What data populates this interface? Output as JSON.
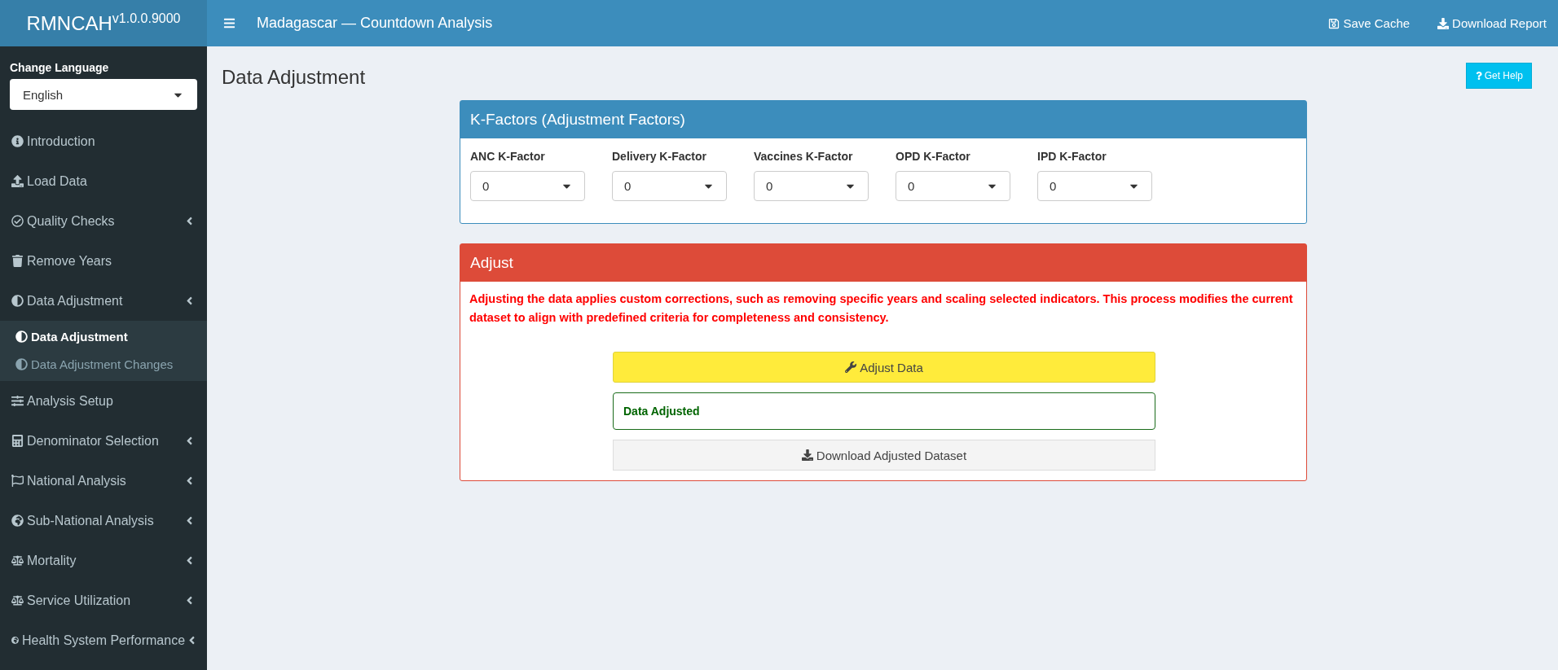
{
  "brand": {
    "title": "RMNCAH$^{v1.0.0.9000}$"
  },
  "header": {
    "title": "Madagascar — Countdown Analysis",
    "actions": [
      {
        "label": "Save Cache"
      },
      {
        "label": "Download Report"
      }
    ]
  },
  "sidebar": {
    "language_label": "Change Language",
    "language_value": "English",
    "items": [
      {
        "label": "Introduction",
        "has_submenu": false
      },
      {
        "label": "Load Data",
        "has_submenu": false
      },
      {
        "label": "Quality Checks",
        "has_submenu": true
      },
      {
        "label": "Remove Years",
        "has_submenu": false
      },
      {
        "label": "Data Adjustment",
        "has_submenu": true,
        "expanded": true,
        "children": [
          {
            "label": "Data Adjustment",
            "selected": true
          },
          {
            "label": "Data Adjustment Changes",
            "selected": false
          }
        ]
      },
      {
        "label": "Analysis Setup",
        "has_submenu": false
      },
      {
        "label": "Denominator Selection",
        "has_submenu": true
      },
      {
        "label": "National Analysis",
        "has_submenu": true
      },
      {
        "label": "Sub-National Analysis",
        "has_submenu": true
      },
      {
        "label": "Mortality",
        "has_submenu": true
      },
      {
        "label": "Service Utilization",
        "has_submenu": true
      },
      {
        "label": "Health System Performance",
        "has_submenu": true
      }
    ]
  },
  "page": {
    "title": "Data Adjustment",
    "help_button": "Get Help"
  },
  "kfactors_card": {
    "title": "K-Factors (Adjustment Factors)",
    "fields": [
      {
        "label": "ANC K-Factor",
        "value": "0"
      },
      {
        "label": "Delivery K-Factor",
        "value": "0"
      },
      {
        "label": "Vaccines K-Factor",
        "value": "0"
      },
      {
        "label": "OPD K-Factor",
        "value": "0"
      },
      {
        "label": "IPD K-Factor",
        "value": "0"
      }
    ]
  },
  "adjust_card": {
    "title": "Adjust",
    "description": "Adjusting the data applies custom corrections, such as removing specific years and scaling selected indicators. This process modifies the current dataset to align with predefined criteria for completeness and consistency.",
    "adjust_button": "Adjust Data",
    "status": "Data Adjusted",
    "download_button": "Download Adjusted Dataset"
  }
}
